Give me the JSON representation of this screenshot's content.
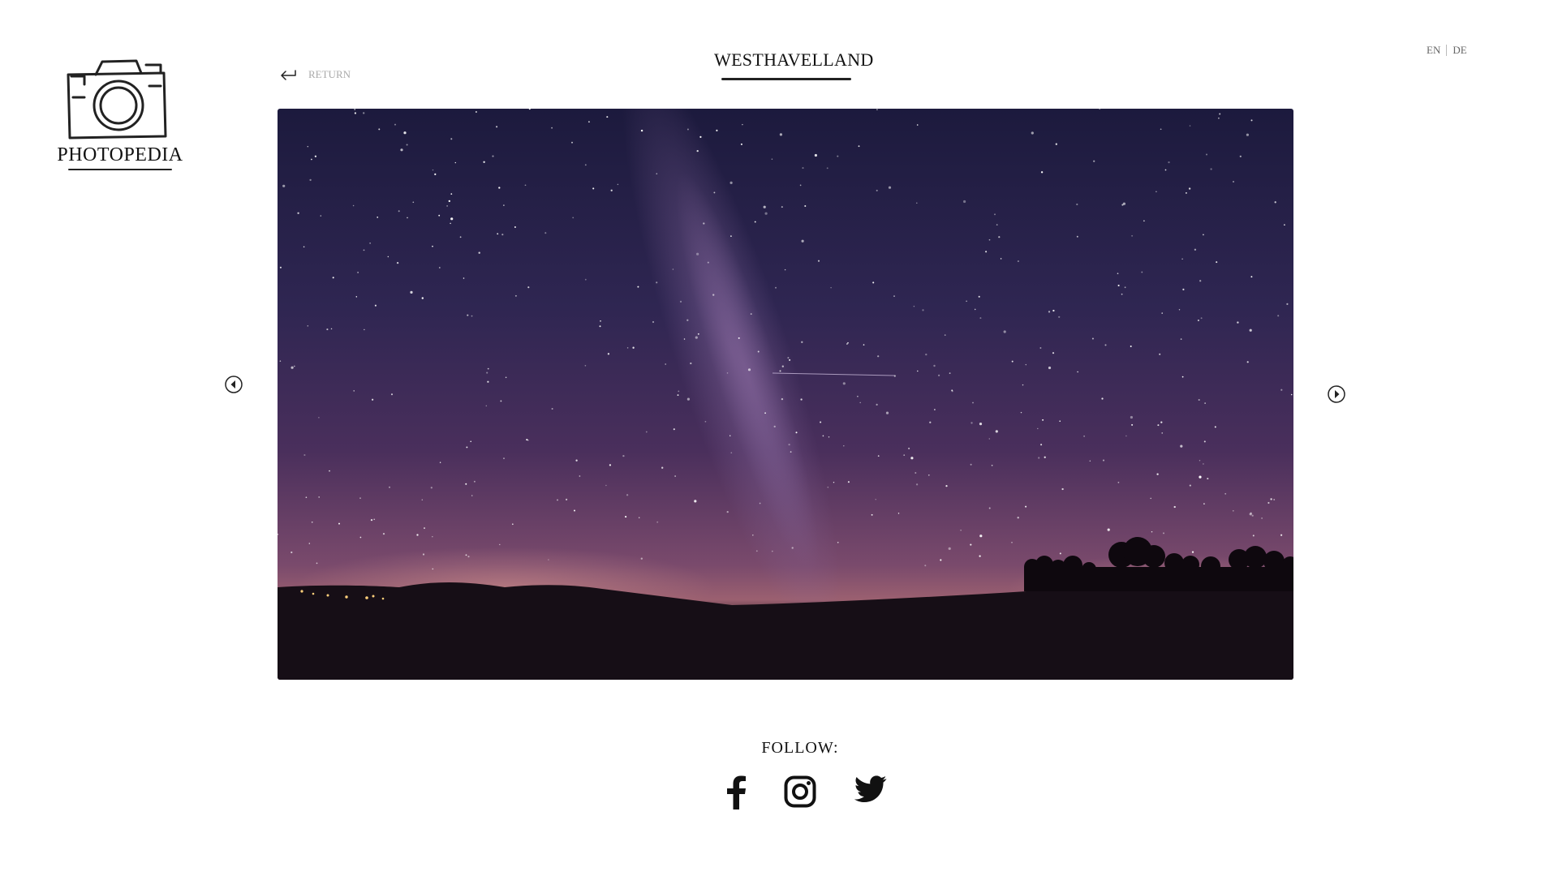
{
  "brand": {
    "name": "PHOTOPEDIA",
    "logo_icon": "camera-icon"
  },
  "nav": {
    "return_label": "RETURN",
    "return_icon": "return-arrow-icon"
  },
  "album": {
    "title": "WESTHAVELLAND"
  },
  "language": {
    "options": [
      "EN",
      "DE"
    ]
  },
  "gallery": {
    "photo_icon": "milky-way-night-sky-photo",
    "prev_icon": "chevron-left-circle-icon",
    "next_icon": "chevron-right-circle-icon"
  },
  "footer": {
    "follow_label": "FOLLOW:",
    "social": [
      {
        "icon": "facebook-icon"
      },
      {
        "icon": "instagram-icon"
      },
      {
        "icon": "twitter-icon"
      }
    ]
  },
  "colors": {
    "text": "#111111",
    "muted": "#aaaaaa",
    "background": "#ffffff"
  }
}
